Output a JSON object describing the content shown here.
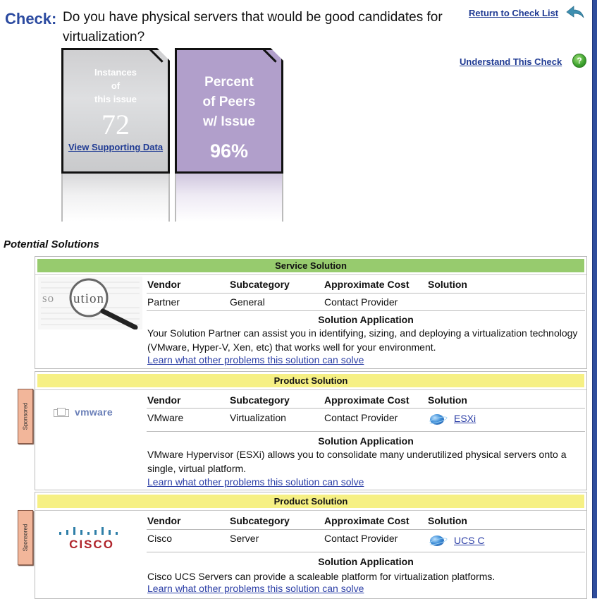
{
  "header": {
    "check_label": "Check:",
    "question": "Do you have physical servers that would be good candidates for virtualization?",
    "return_link": "Return to Check List",
    "understand_link": "Understand This Check",
    "help_icon_glyph": "?"
  },
  "tiles": {
    "instances": {
      "label_lines": [
        "Instances",
        "of",
        "this issue"
      ],
      "value": "72",
      "link": "View Supporting Data"
    },
    "peers": {
      "label_lines": [
        "Percent",
        "of Peers",
        "w/ Issue"
      ],
      "value": "96%"
    }
  },
  "section_title": "Potential Solutions",
  "columns": {
    "vendor": "Vendor",
    "subcategory": "Subcategory",
    "cost": "Approximate Cost",
    "solution": "Solution",
    "application": "Solution Application"
  },
  "solutions": [
    {
      "type": "Service Solution",
      "color": "#97cb6e",
      "logo": "solution-magnifier",
      "logo_text": "Solution",
      "sponsored": false,
      "vendor": "Partner",
      "subcategory": "General",
      "cost": "Contact Provider",
      "solution_link": "",
      "application_text": "Your Solution Partner can assist you in identifying, sizing, and deploying  a virtualization technology (VMware, Hyper-V, Xen, etc) that works well for your environment.",
      "learn_link": "Learn what other problems this solution can solve"
    },
    {
      "type": "Product Solution",
      "color": "#f6f084",
      "logo": "vmware-logo",
      "logo_text": "vmware",
      "sponsored": true,
      "sponsored_label": "Sponsored",
      "vendor": "VMware",
      "subcategory": "Virtualization",
      "cost": "Contact Provider",
      "solution_link": "ESXi",
      "application_text": "VMware Hypervisor (ESXi) allows you to consolidate many underutilized physical servers onto a single, virtual platform.",
      "learn_link": "Learn what other problems this solution can solve"
    },
    {
      "type": "Product Solution",
      "color": "#f6f084",
      "logo": "cisco-logo",
      "logo_text": "CISCO",
      "sponsored": true,
      "sponsored_label": "Sponsored",
      "vendor": "Cisco",
      "subcategory": "Server",
      "cost": "Contact Provider",
      "solution_link": "UCS C",
      "application_text": "Cisco UCS Servers can provide a scaleable platform for virtualization platforms.",
      "learn_link": "Learn what other problems this solution can solve"
    }
  ]
}
